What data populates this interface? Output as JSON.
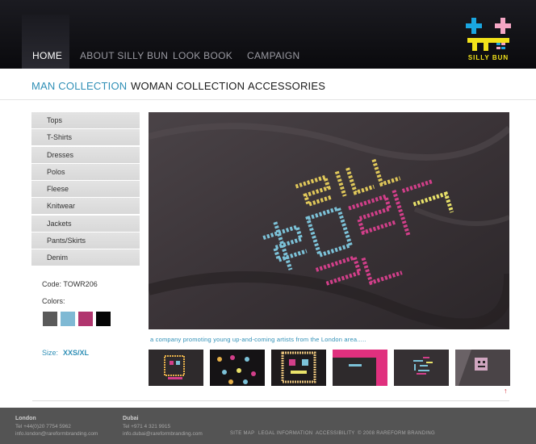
{
  "nav": {
    "items": [
      {
        "label": "HOME"
      },
      {
        "label": "ABOUT SILLY BUN"
      },
      {
        "label": "LOOK BOOK"
      },
      {
        "label": "CAMPAIGN"
      }
    ],
    "active": "HOME"
  },
  "logo": {
    "text": "SILLY BUN",
    "plus_colors": [
      "#1aa6e0",
      "#f4a6c4"
    ],
    "bar_color": "#f2e21a"
  },
  "collections": [
    {
      "label": "MAN COLLECTION"
    },
    {
      "label": "WOMAN COLLECTION"
    },
    {
      "label": "ACCESSORIES"
    }
  ],
  "sidebar": {
    "items": [
      {
        "label": "Tops"
      },
      {
        "label": "T-Shirts"
      },
      {
        "label": "Dresses"
      },
      {
        "label": "Polos"
      },
      {
        "label": "Fleese"
      },
      {
        "label": "Knitwear"
      },
      {
        "label": "Jackets"
      },
      {
        "label": "Pants/Skirts"
      },
      {
        "label": "Denim"
      }
    ]
  },
  "product": {
    "code": "Code: TOWR206",
    "colors_label": "Colors:",
    "colors": [
      "#5a5a5a",
      "#7fb9d4",
      "#b0356e",
      "#050505"
    ],
    "size_label": "Size:",
    "size_value": "XXS/XL"
  },
  "caption": "a company promoting young up-and-coming artists from the London area.....",
  "footer": {
    "london": {
      "city": "London",
      "tel": "Tel +44(0)20 7754 5962",
      "email": "info.london@rareformbranding.com"
    },
    "dubai": {
      "city": "Dubai",
      "tel": "Tel +971 4 321 9915",
      "email": "info.dubai@rareformbranding.com"
    },
    "links": [
      "SITE MAP",
      "LEGAL INFORMATION",
      "ACCESSIBILITY",
      "© 2008 RAREFORM BRANDING"
    ]
  }
}
